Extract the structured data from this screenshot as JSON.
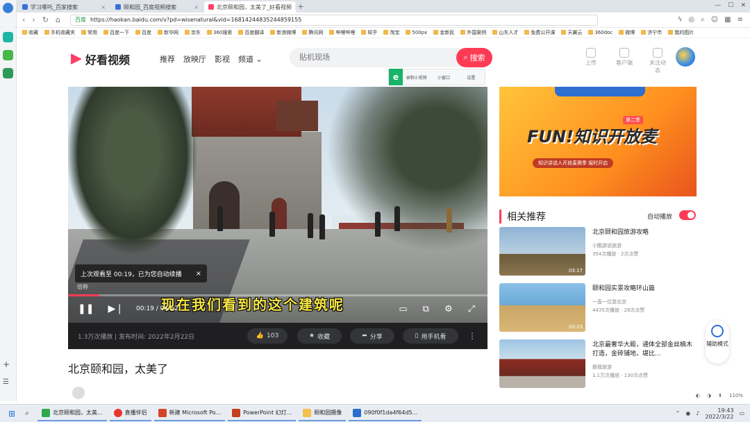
{
  "browser": {
    "tabs": [
      {
        "label": "学习哪吒_百家搜索",
        "active": false
      },
      {
        "label": "颐和园_百度视频搜索",
        "active": false
      },
      {
        "label": "北京颐和园，太美了_好看视频",
        "active": true
      }
    ],
    "url": "https://haokan.baidu.com/v?pd=wisenatural&vid=16814244835244859155",
    "safe_label": "百度",
    "bookmarks": [
      "收藏",
      "手机收藏夹",
      "常用",
      "百度一下",
      "百度",
      "新华网",
      "京东",
      "360搜索",
      "百度翻译",
      "新浪微博",
      "腾讯网",
      "哔哩哔哩",
      "知乎",
      "淘宝",
      "500px",
      "金新民",
      "外国案例",
      "山东人才",
      "免费公开课",
      "天翼云",
      "360doc",
      "微博",
      "济宁市",
      "我的图片"
    ]
  },
  "site": {
    "logo": "好看视频",
    "nav": [
      "推荐",
      "放映厅",
      "影视",
      "频道 ⌄"
    ],
    "search_placeholder": "贴机现场",
    "search_button": "搜索",
    "tools": [
      "上传",
      "客户端",
      "关注动态"
    ]
  },
  "recorder": {
    "badge": "e",
    "items": [
      "录制小视频",
      "小窗口",
      "设置"
    ]
  },
  "player": {
    "resume_tip": "上次观看至 00:19，已为您自动续播",
    "tip_sub": "倍称",
    "time": "00:19 / 04:12",
    "progress": 0.075,
    "subtitle": "现在我们看到的这个建筑呢",
    "play_icon": "pause",
    "controls_right": [
      "bullet-comment-icon",
      "fullscreen-web-icon",
      "settings-icon",
      "fullscreen-icon"
    ]
  },
  "meta": {
    "stats": "1.3万次播放 | 发布时间: 2022年2月22日",
    "like": "103",
    "collect": "收藏",
    "share": "分享",
    "phone": "用手机看"
  },
  "video_title": "北京颐和园，太美了",
  "ad": {
    "title": "FUN!知识开放麦",
    "badge": "第二季",
    "subtitle": "知识讲说人开放麦赛季 报时开启"
  },
  "related": {
    "heading": "相关推荐",
    "autoplay": "自动播放",
    "items": [
      {
        "title": "北京颐和园旅游攻略",
        "author": "小酷游说旅游",
        "stats": "354次播放 · 2次点赞",
        "duration": "03:17"
      },
      {
        "title": "颐和园实景攻略环山篇",
        "author": "一直一位游北京",
        "stats": "4435次播放 · 28次点赞",
        "duration": "03:23"
      },
      {
        "title": "北京最奢华大殿，通体全部金丝楠木打造，金砖铺地，堪比...",
        "author": "跟我旅游",
        "stats": "1.1万次播放 · 130次点赞",
        "duration": ""
      }
    ]
  },
  "assistant": {
    "label": "辅助模式"
  },
  "taskbar": {
    "items": [
      "北京颐和园，太美...",
      "直播伴侣",
      "新建 Microsoft Po...",
      "PowerPoint 幻灯...",
      "颐和园摄像",
      "090f0f1da4f64d5..."
    ],
    "time": "19:43",
    "date": "2022/3/22",
    "zoom": "110%"
  }
}
